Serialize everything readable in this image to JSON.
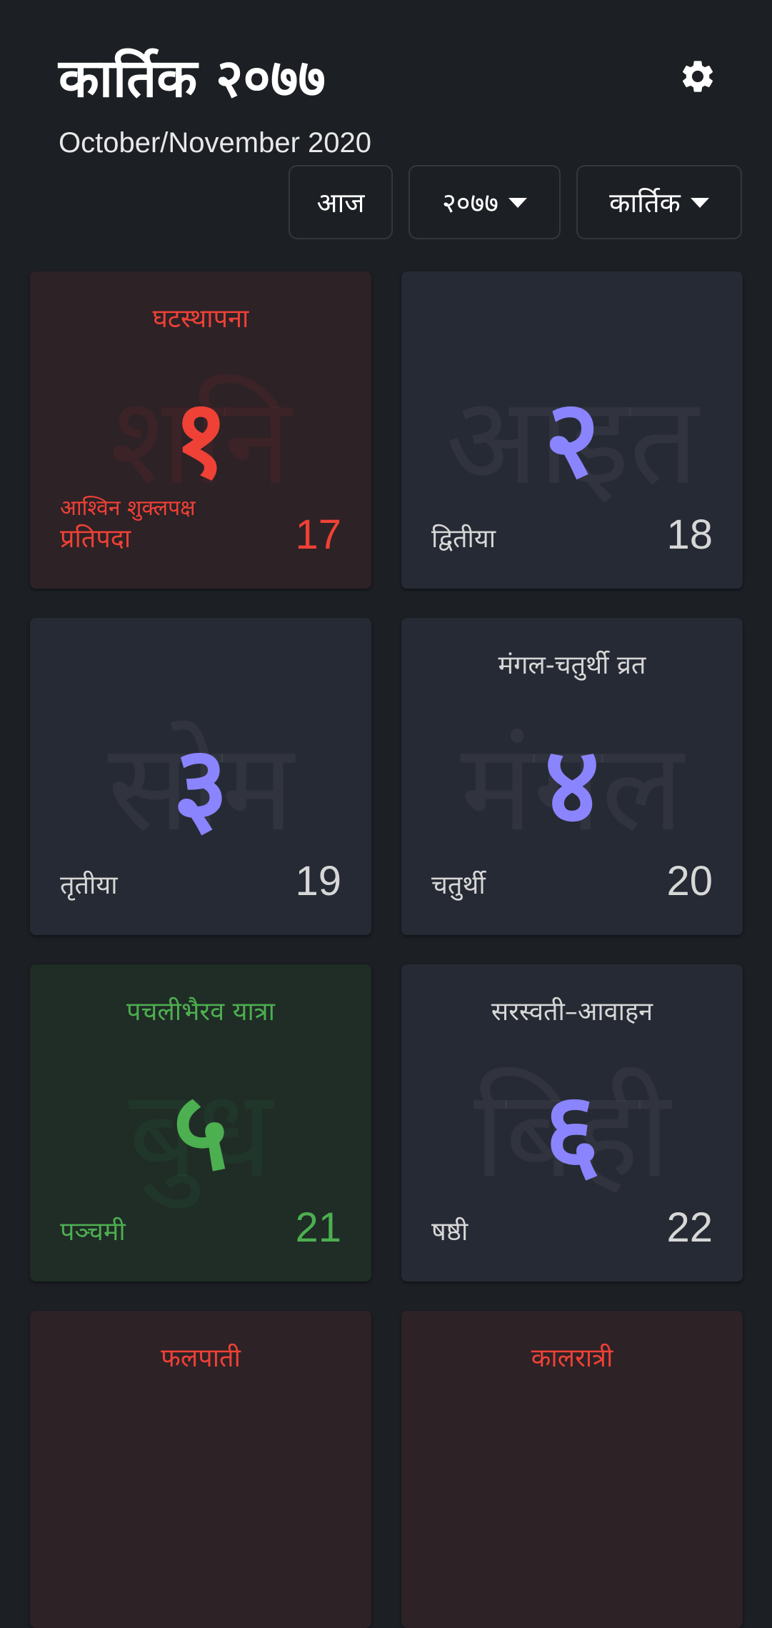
{
  "header": {
    "title": "कार्तिक २०७७",
    "subtitle": "October/November 2020"
  },
  "controls": {
    "today_label": "आज",
    "year_value": "२०७७",
    "month_value": "कार्तिक"
  },
  "colors": {
    "holiday": "#ef4136",
    "festival": "#4caf50",
    "date_number": "#8a84ff"
  },
  "days": [
    {
      "day": "१",
      "weekday": "शनि",
      "event": "घटस्थापना",
      "month_label": "आश्विन शुक्लपक्ष",
      "tithi": "प्रतिपदा",
      "eng": "17",
      "type": "holiday"
    },
    {
      "day": "२",
      "weekday": "आइत",
      "event": "",
      "month_label": "",
      "tithi": "द्वितीया",
      "eng": "18",
      "type": "normal"
    },
    {
      "day": "३",
      "weekday": "सोम",
      "event": "",
      "month_label": "",
      "tithi": "तृतीया",
      "eng": "19",
      "type": "normal"
    },
    {
      "day": "४",
      "weekday": "मंगल",
      "event": "मंगल-चतुर्थी व्रत",
      "month_label": "",
      "tithi": "चतुर्थी",
      "eng": "20",
      "type": "normal"
    },
    {
      "day": "५",
      "weekday": "बुध",
      "event": "पचलीभैरव यात्रा",
      "month_label": "",
      "tithi": "पञ्चमी",
      "eng": "21",
      "type": "festival"
    },
    {
      "day": "६",
      "weekday": "बिही",
      "event": "सरस्वती–आवाहन",
      "month_label": "",
      "tithi": "षष्ठी",
      "eng": "22",
      "type": "normal"
    },
    {
      "day": "",
      "weekday": "",
      "event": "फलपाती",
      "month_label": "",
      "tithi": "",
      "eng": "",
      "type": "holiday"
    },
    {
      "day": "",
      "weekday": "",
      "event": "कालरात्री",
      "month_label": "",
      "tithi": "",
      "eng": "",
      "type": "holiday"
    }
  ]
}
